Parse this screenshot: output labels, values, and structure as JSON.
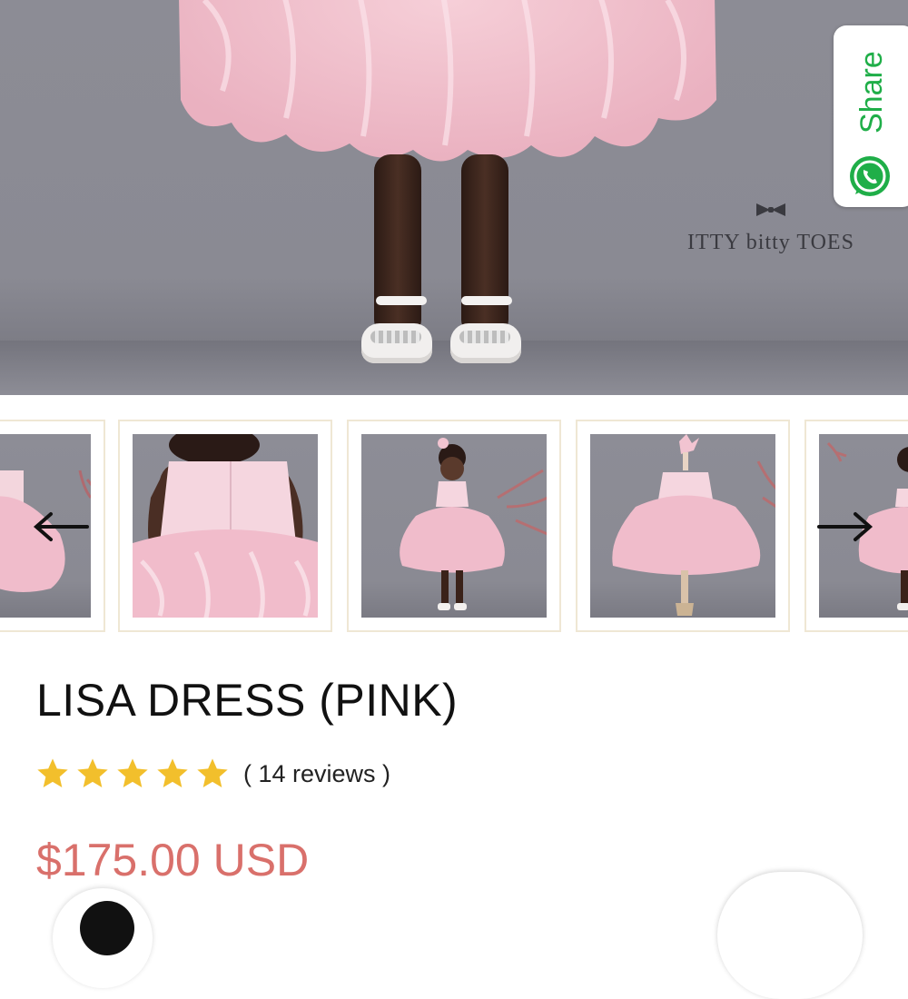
{
  "hero": {
    "image_alt": "Pink tulle dress photo",
    "logo_text": "ITTY bitty TOES"
  },
  "share": {
    "label": "Share",
    "icon": "whatsapp-icon",
    "color": "#1fae48"
  },
  "gallery": {
    "prev_icon": "arrow-left-icon",
    "next_icon": "arrow-right-icon",
    "thumbnails": [
      {
        "view": "side partial"
      },
      {
        "view": "back detail"
      },
      {
        "view": "girl wearing dress"
      },
      {
        "view": "dress on mannequin"
      },
      {
        "view": "side partial"
      }
    ]
  },
  "product": {
    "title": "LISA DRESS (PINK)",
    "rating": 5,
    "rating_max": 5,
    "reviews_text": "( 14 reviews )",
    "price": "$175.00 USD",
    "star_color": "#f2bf2c",
    "price_color": "#d9706b"
  }
}
